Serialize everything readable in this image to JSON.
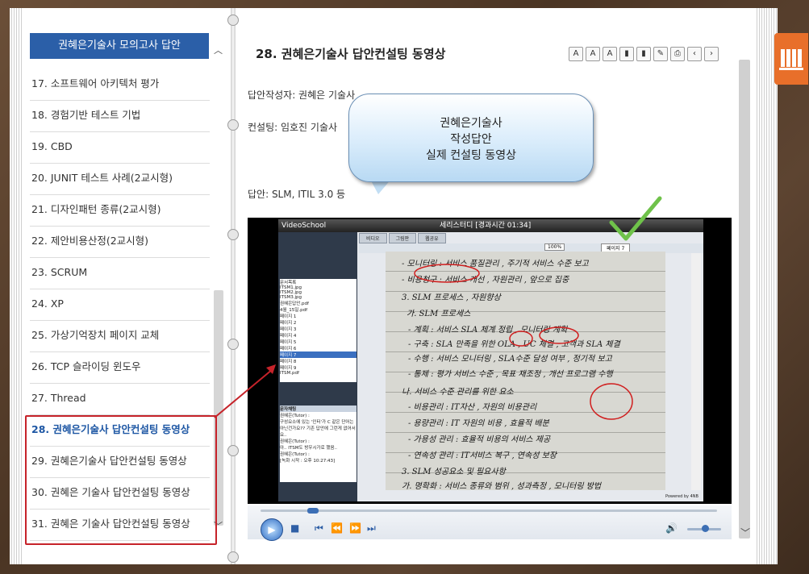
{
  "toc": {
    "header": "권혜은기술사 모의고사 답안",
    "items": [
      {
        "label": "17. 소프트웨어 아키텍처 평가"
      },
      {
        "label": "18. 경험기반 테스트 기법"
      },
      {
        "label": "19. CBD"
      },
      {
        "label": "20. JUNIT 테스트 사례(2교시형)"
      },
      {
        "label": "21. 디자인패턴 종류(2교시형)"
      },
      {
        "label": "22. 제안비용산정(2교시형)"
      },
      {
        "label": "23. SCRUM"
      },
      {
        "label": "24. XP"
      },
      {
        "label": "25. 가상기억장치 페이지 교체"
      },
      {
        "label": "26. TCP 슬라이딩 윈도우"
      },
      {
        "label": "27. Thread"
      },
      {
        "label": "28. 권혜은기술사 답안컨설팅 동영상"
      },
      {
        "label": "29. 권혜은기술사 답안컨설팅 동영상"
      },
      {
        "label": "30. 권혜은 기술사 답안컨설팅 동영상"
      },
      {
        "label": "31. 권혜은 기술사 답안컨설팅 동영상"
      }
    ],
    "active_index": 11
  },
  "document": {
    "title": "28. 권혜은기술사 답안컨설팅 동영상",
    "author_line": "답안작성자: 권혜은 기술사",
    "consult_line": "컨설팅: 임호진 기술사",
    "answer_line": "답안: SLM, ITIL 3.0 등"
  },
  "callout": {
    "line1": "권혜은기술사",
    "line2": "작성답안",
    "line3": "실제 컨설팅 동영상"
  },
  "toolbar": {
    "font_shrink": "A",
    "font_grow": "A",
    "font_reset": "A",
    "bookmark": "▮",
    "bookmark_list": "▮",
    "memo": "✎",
    "print": "⎙",
    "prev": "‹",
    "next": "›"
  },
  "video": {
    "app_name": "VideoSchool",
    "window_title": "세리스터디 [경과시간 01:34]",
    "tabs": [
      "비디오",
      "그림판",
      "웹공유"
    ],
    "zoom": "100%",
    "page_select": "페이지 7",
    "tree_items": [
      "문서목록",
      "ITSM1.jpg",
      "ITSM2.jpg",
      "ITSM3.jpg",
      "권혜은답안.pdf",
      "4월_15일.pdf",
      "페이지 1",
      "페이지 2",
      "페이지 3",
      "페이지 4",
      "페이지 5",
      "페이지 6",
      "페이지 7",
      "페이지 8",
      "페이지 9",
      "ITSM.pdf"
    ],
    "chat_title": "문자채팅",
    "chat_lines": [
      "권혜은(Tutor) :",
      "구성요소에 있는 '인터'가 C 같은 단어는 아닌건가요?? 기존 답안에 그런게 없어서요..",
      "권혜은(Tutor) :",
      "아.. ITSM도 방우시가로 했음..",
      "권혜은(Tutor) :"
    ],
    "chat_status": "[녹화 시작 : 오후 10:27:43]",
    "powered": "Powered by 4NB",
    "handwriting": [
      "- 모니터링 : 서비스 품질관리 , 주기적 서비스 수준 보고",
      "- 비용청구 : 서비스 개선 , 자원관리 , 앞으로 집중",
      "3. SLM 프로세스 , 자원향상",
      "가. SLM 프로세스",
      "- 계획 : 서비스 SLA 체계 정립 , 모니터링 계획",
      "- 구축 : SLA 만족을 위한 OLA , UC 체결 , 고객과 SLA 체결",
      "- 수행 : 서비스 모니터링 , SLA수준 달성 여부 , 정기적 보고",
      "- 통제 : 평가 서비스 수준 , 목표 재조정 , 개선 프로그램 수행",
      "나. 서비스 수준 관리를 위한 요소",
      "- 비용관리 : IT자산 , 자원의 비용관리",
      "- 용량관리 : IT 자원의 비용 , 효율적 배분",
      "- 가용성 관리 : 효율적 비용의 서비스 제공",
      "- 연속성 관리 : IT서비스 복구 , 연속성 보장",
      "3. SLM 성공요소 및 필요사항",
      "가. 명확화 : 서비스 종류와 범위 , 성과측정 , 모니터링 방법"
    ]
  },
  "colors": {
    "toc_header_bg": "#2b5fa8",
    "active_item": "#1e57a4",
    "highlight": "#c6232a",
    "side_tab": "#e86f2a"
  }
}
